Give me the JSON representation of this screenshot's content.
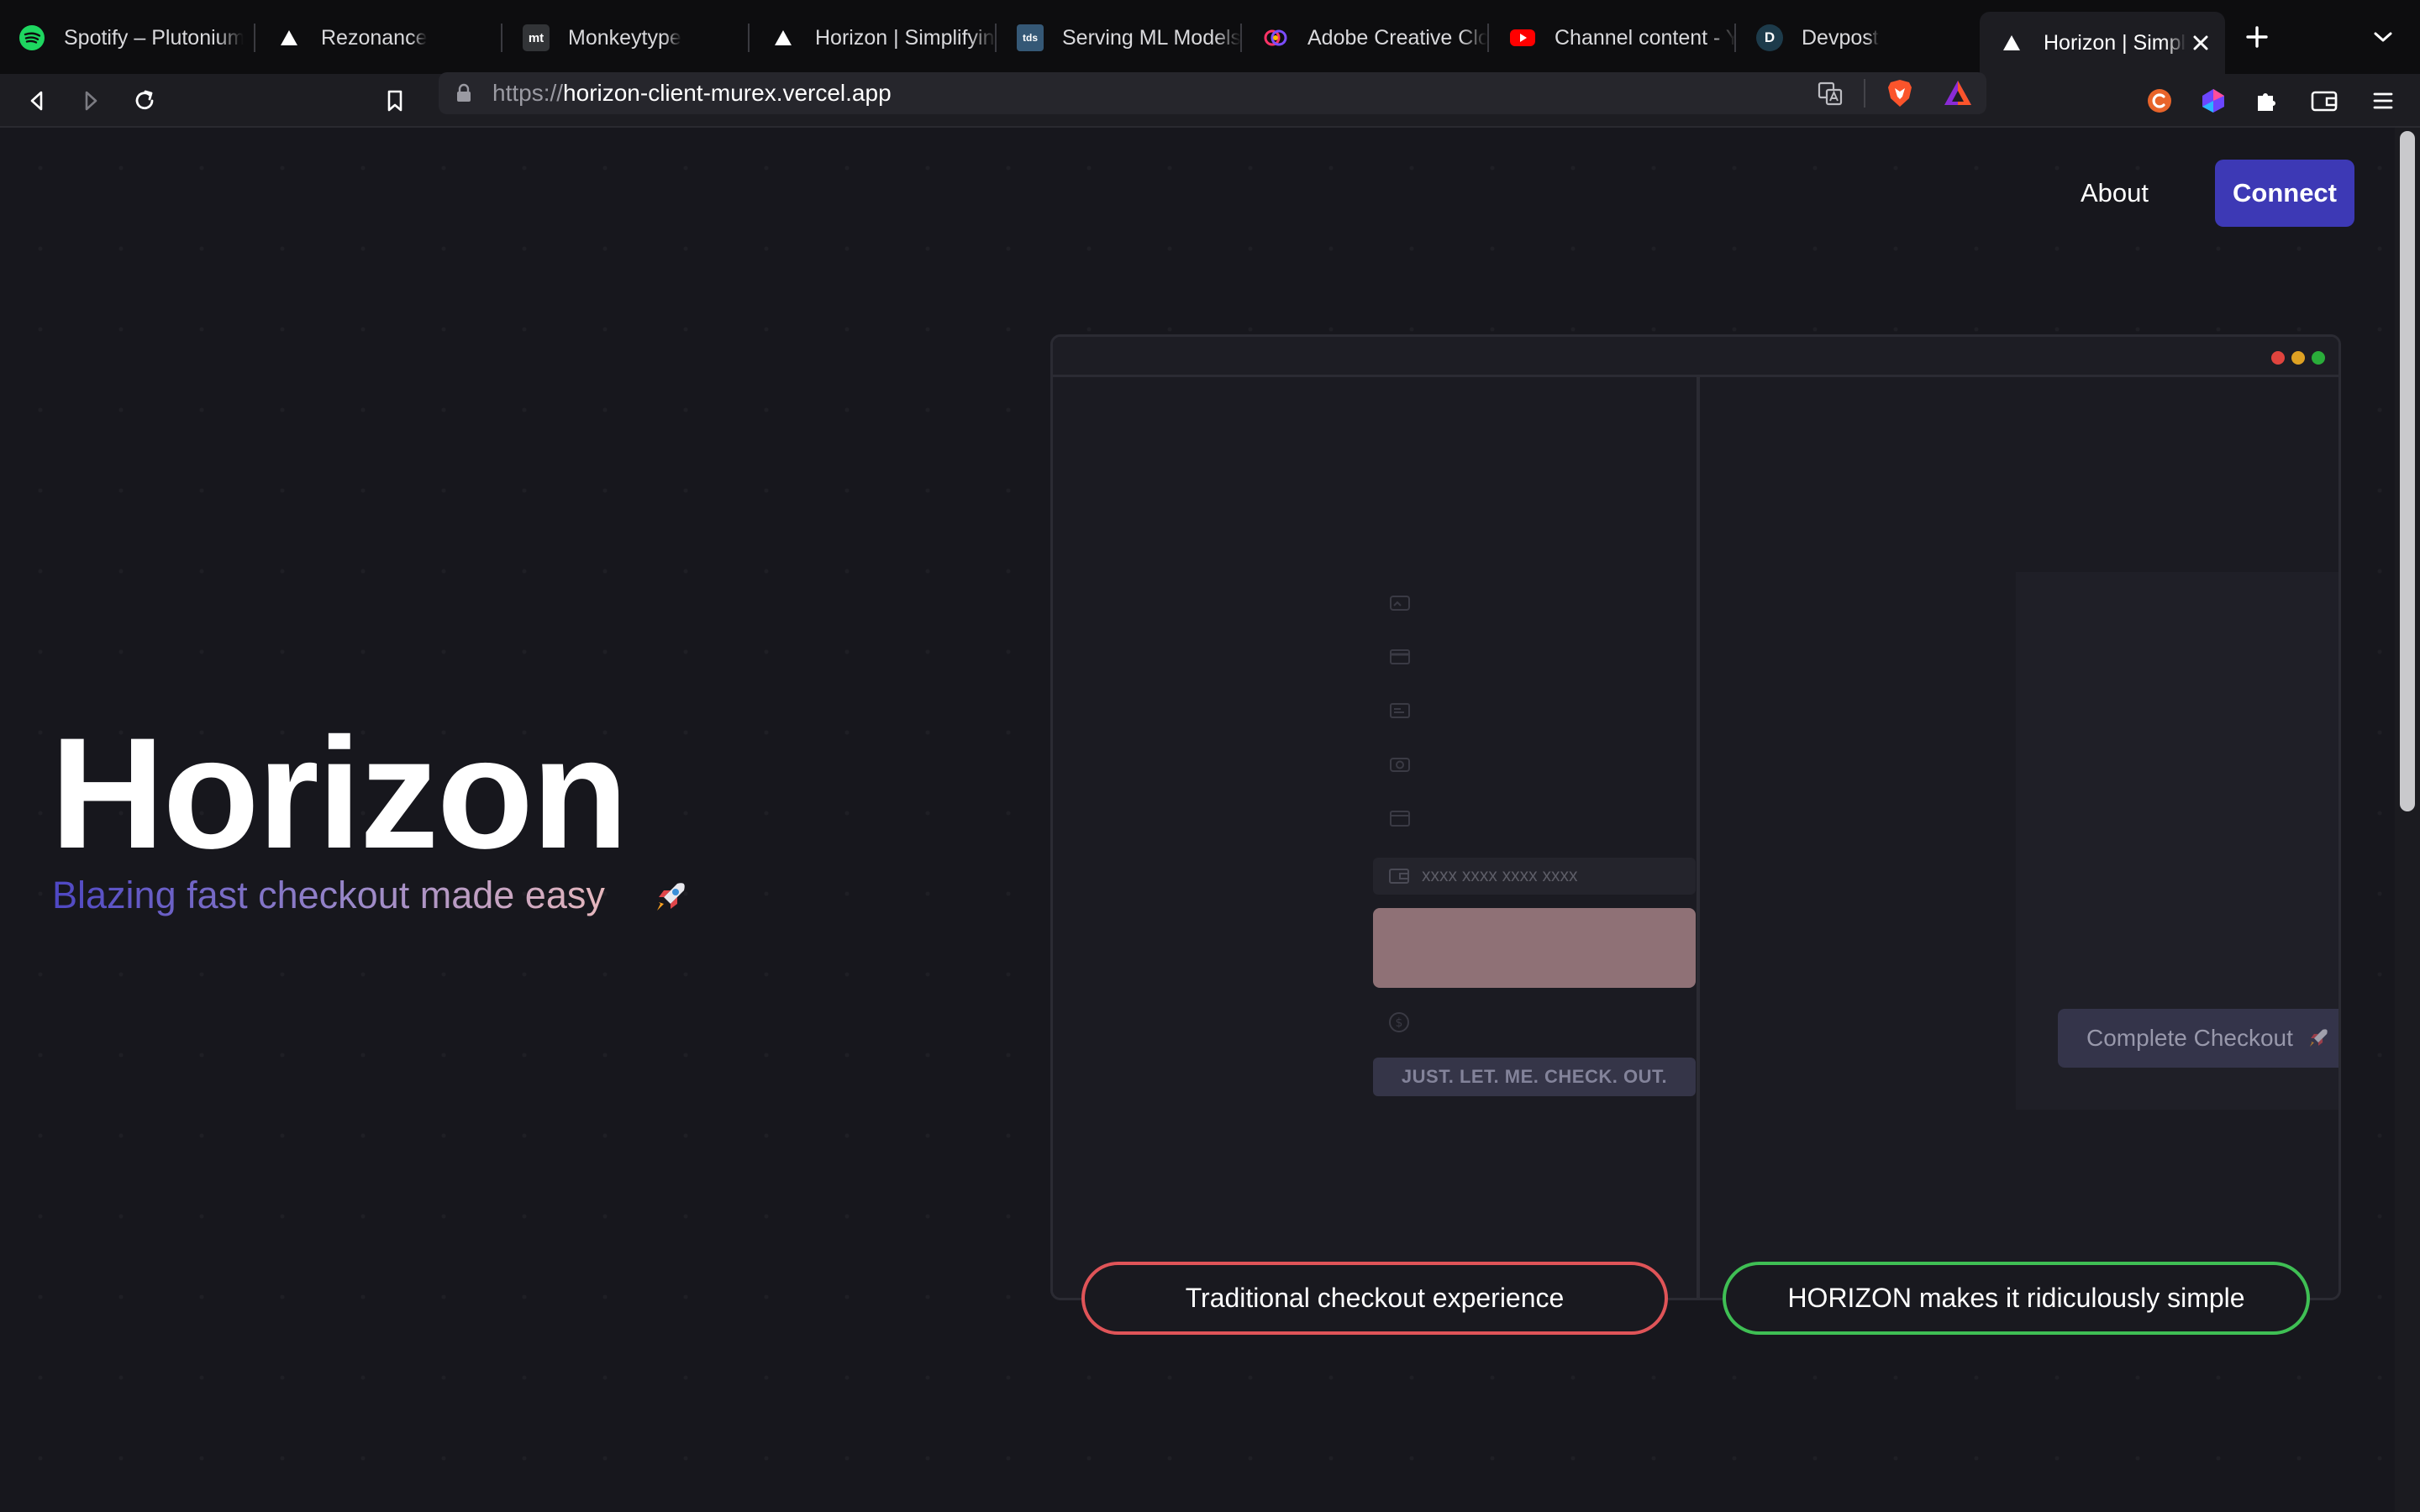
{
  "browser": {
    "tabs": [
      {
        "title": "Spotify – Plutonium",
        "icon": "spotify-icon"
      },
      {
        "title": "Rezonance",
        "icon": "triangle-icon"
      },
      {
        "title": "Monkeytype",
        "icon": "monkeytype-icon"
      },
      {
        "title": "Horizon | Simplifying",
        "icon": "triangle-icon"
      },
      {
        "title": "Serving ML Models",
        "icon": "tds-icon"
      },
      {
        "title": "Adobe Creative Cloud",
        "icon": "adobe-cc-icon"
      },
      {
        "title": "Channel content - YouTube",
        "icon": "youtube-icon"
      },
      {
        "title": "Devpost",
        "icon": "devpost-icon"
      },
      {
        "title": "Horizon | Simplifying",
        "icon": "triangle-icon",
        "active": true
      }
    ],
    "tab_badges": {
      "monkeytype": "mt",
      "tds": "tds",
      "devpost": "D"
    },
    "url": {
      "scheme": "https://",
      "host": "horizon-client-murex.vercel.app"
    },
    "colors": {
      "brave_orange": "#fb542b",
      "spotify_green": "#1ed760",
      "youtube_red": "#ff0000"
    }
  },
  "nav": {
    "about": "About",
    "connect": "Connect"
  },
  "hero": {
    "title": "Horizon",
    "subtitle": "Blazing fast checkout made easy"
  },
  "demo": {
    "card_placeholder": "xxxx xxxx xxxx xxxx",
    "just_checkout": "JUST. LET. ME. CHECK. OUT.",
    "complete_checkout": "Complete Checkout",
    "form_icons": [
      "image-icon",
      "credit-card-icon",
      "id-card-icon",
      "camera-icon",
      "calendar-icon"
    ]
  },
  "labels": {
    "traditional": "Traditional checkout experience",
    "horizon": "HORIZON makes it ridiculously simple"
  },
  "colors": {
    "connect": "#3d39b5",
    "traditional_border": "#e05458",
    "horizon_border": "#3fbf54",
    "subtitle_gradient": [
      "#4e47c4",
      "#9a88c8",
      "#e7b8bd"
    ]
  }
}
